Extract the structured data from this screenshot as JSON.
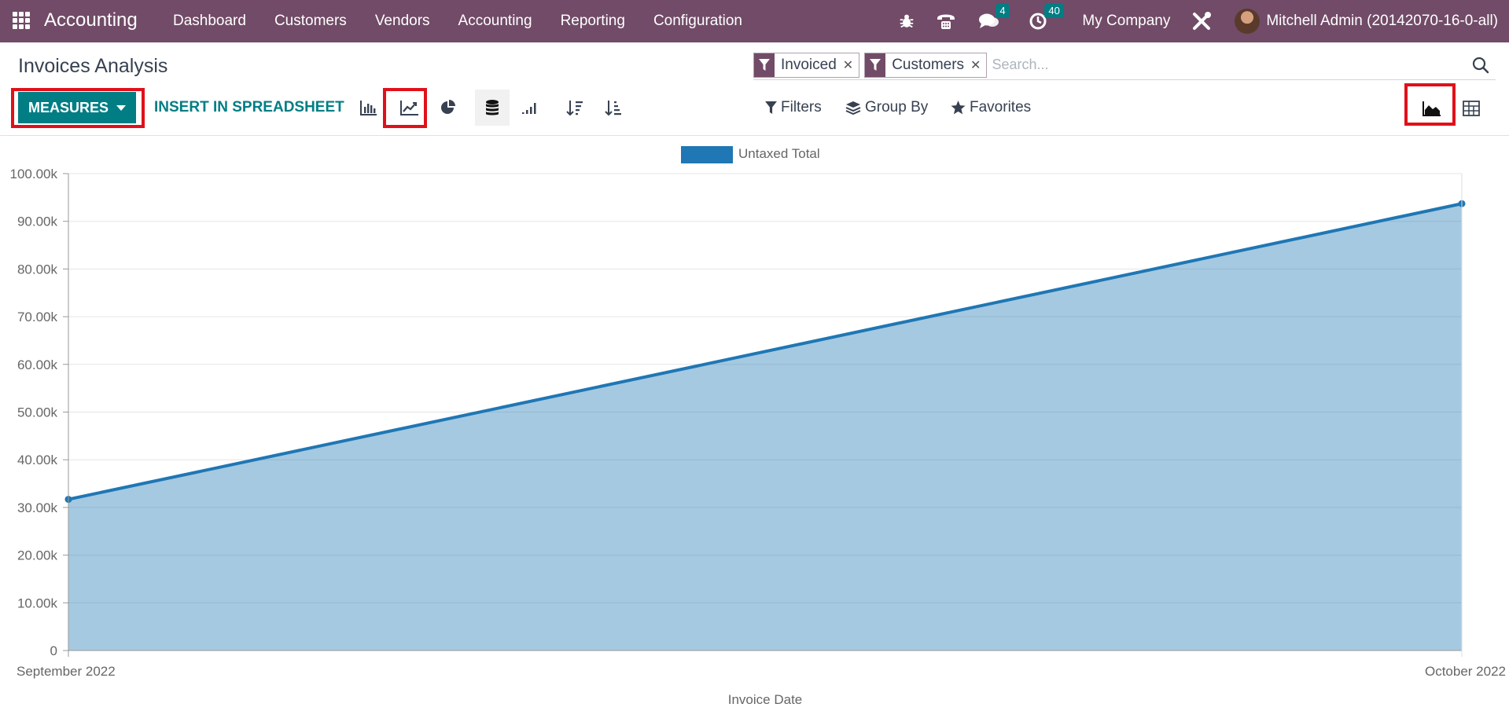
{
  "navbar": {
    "brand": "Accounting",
    "menu": [
      "Dashboard",
      "Customers",
      "Vendors",
      "Accounting",
      "Reporting",
      "Configuration"
    ],
    "messages_count": "4",
    "activities_count": "40",
    "company": "My Company",
    "user": "Mitchell Admin (20142070-16-0-all)",
    "color": "#714b67"
  },
  "page": {
    "title": "Invoices Analysis"
  },
  "search": {
    "facets": [
      {
        "label": "Invoiced",
        "icon": "filter-icon"
      },
      {
        "label": "Customers",
        "icon": "filter-icon"
      }
    ],
    "placeholder": "Search..."
  },
  "toolbar": {
    "measures_label": "MEASURES",
    "spreadsheet_label": "INSERT IN SPREADSHEET",
    "filters_label": "Filters",
    "groupby_label": "Group By",
    "favorites_label": "Favorites",
    "accent": "#017e84"
  },
  "chart_data": {
    "type": "area",
    "x": [
      "September 2022",
      "October 2022"
    ],
    "series": [
      {
        "name": "Untaxed Total",
        "values": [
          31700,
          93700
        ],
        "color": "#1f77b4"
      }
    ],
    "xlabel": "Invoice Date",
    "ylabel": "",
    "ylim": [
      0,
      100000
    ],
    "yticks": [
      "0",
      "10.00k",
      "20.00k",
      "30.00k",
      "40.00k",
      "50.00k",
      "60.00k",
      "70.00k",
      "80.00k",
      "90.00k",
      "100.00k"
    ],
    "grid": true,
    "legend": "top-center"
  }
}
